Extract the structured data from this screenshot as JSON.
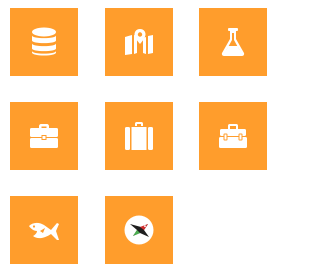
{
  "colors": {
    "tile_background": "#ff9d2c",
    "icon": "#ffffff",
    "badge_background": "#ffffff",
    "badge_mark_dark": "#1f1f1f",
    "badge_mark_accent": "#d32f2f",
    "badge_mark_green": "#4caf50"
  },
  "tiles": [
    {
      "icon": "database-icon"
    },
    {
      "icon": "map-marker-icon"
    },
    {
      "icon": "flask-icon"
    },
    {
      "icon": "briefcase-icon"
    },
    {
      "icon": "suitcase-icon"
    },
    {
      "icon": "toolbox-icon"
    },
    {
      "icon": "fish-icon"
    },
    {
      "icon": "bird-logo-icon"
    }
  ]
}
